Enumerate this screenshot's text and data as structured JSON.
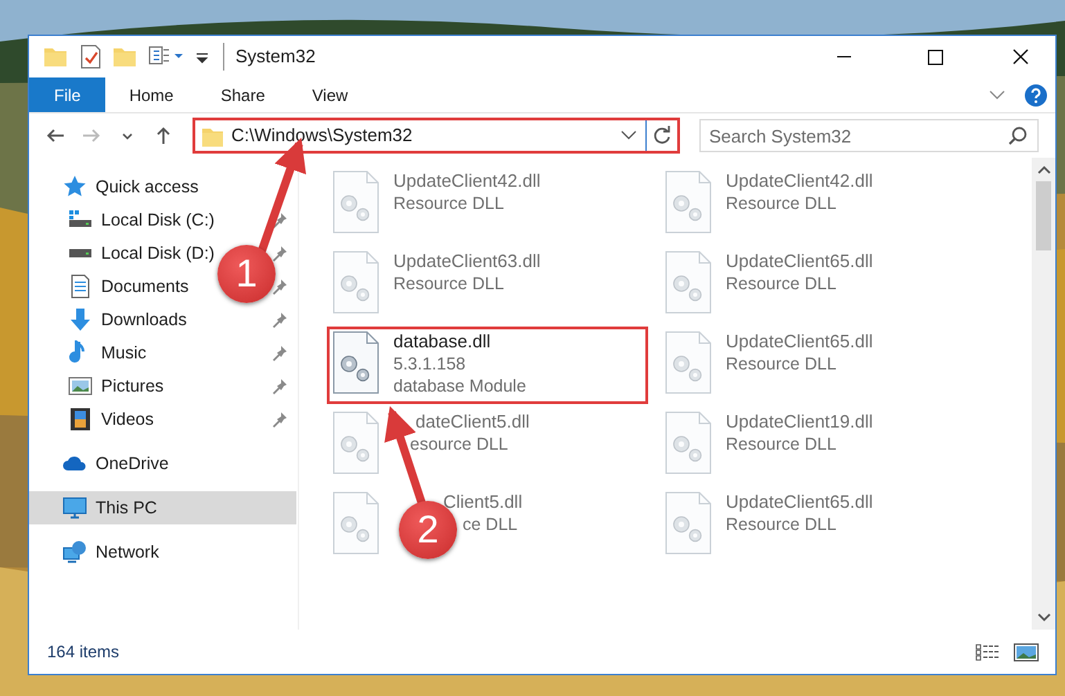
{
  "window": {
    "title": "System32"
  },
  "ribbon_tabs": [
    {
      "label": "File",
      "selected": true
    },
    {
      "label": "Home",
      "selected": false
    },
    {
      "label": "Share",
      "selected": false
    },
    {
      "label": "View",
      "selected": false
    }
  ],
  "address": {
    "path": "C:\\Windows\\System32",
    "highlighted": true
  },
  "search": {
    "placeholder": "Search System32"
  },
  "sidebar": {
    "items": [
      {
        "label": "Quick access",
        "selected": false,
        "children": [
          {
            "label": "Local Disk (C:)",
            "pinned": true
          },
          {
            "label": "Local Disk (D:)",
            "pinned": true
          },
          {
            "label": "Documents",
            "pinned": true
          },
          {
            "label": "Downloads",
            "pinned": true
          },
          {
            "label": "Music",
            "pinned": true
          },
          {
            "label": "Pictures",
            "pinned": true
          },
          {
            "label": "Videos",
            "pinned": true
          }
        ]
      },
      {
        "label": "OneDrive",
        "selected": false
      },
      {
        "label": "This PC",
        "selected": true
      },
      {
        "label": "Network",
        "selected": false
      }
    ]
  },
  "files": [
    {
      "name": "UpdateClient42.dll",
      "line_2": "Resource DLL",
      "faded": true,
      "highlighted": false
    },
    {
      "name": "UpdateClient42.dll",
      "line_2": "Resource DLL",
      "faded": true,
      "highlighted": false
    },
    {
      "name": "UpdateClient63.dll",
      "line_2": "Resource DLL",
      "faded": true,
      "highlighted": false
    },
    {
      "name": "UpdateClient65.dll",
      "line_2": "Resource DLL",
      "faded": true,
      "highlighted": false
    },
    {
      "name": "database.dll",
      "line_2": "5.3.1.158",
      "line_3": "database Module",
      "faded": false,
      "highlighted": true
    },
    {
      "name": "UpdateClient65.dll",
      "line_2": "Resource DLL",
      "faded": true,
      "highlighted": false
    },
    {
      "name": "dateClient5.dll",
      "line_2": "esource DLL",
      "faded": true,
      "highlighted": false
    },
    {
      "name": "UpdateClient19.dll",
      "line_2": "Resource DLL",
      "faded": true,
      "highlighted": false
    },
    {
      "name": "Client5.dll",
      "line_2": "ce DLL",
      "faded": true,
      "highlighted": false
    },
    {
      "name": "UpdateClient65.dll",
      "line_2": "Resource DLL",
      "faded": true,
      "highlighted": false
    }
  ],
  "status_bar": {
    "item_count": "164 items"
  },
  "annotations": [
    {
      "label": "1"
    },
    {
      "label": "2"
    }
  ]
}
